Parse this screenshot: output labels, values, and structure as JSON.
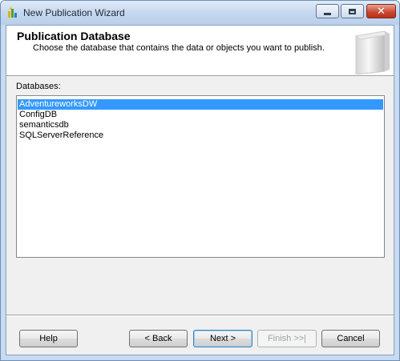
{
  "window": {
    "title": "New Publication Wizard"
  },
  "header": {
    "title": "Publication Database",
    "subtitle": "Choose the database that contains the data or objects you want to publish."
  },
  "databases": {
    "label": "Databases:",
    "items": [
      {
        "label": "AdventureworksDW",
        "selected": true
      },
      {
        "label": "ConfigDB",
        "selected": false
      },
      {
        "label": "semanticsdb",
        "selected": false
      },
      {
        "label": "SQLServerReference",
        "selected": false
      }
    ]
  },
  "buttons": {
    "help": "Help",
    "back": "< Back",
    "next": "Next >",
    "finish": "Finish >>|",
    "cancel": "Cancel"
  },
  "icons": {
    "app": "wizard-icon",
    "minimize": "minimize-icon",
    "maximize": "maximize-icon",
    "close": "close-icon",
    "header": "database-cylinder-graphic"
  },
  "colors": {
    "selection": "#3399ff",
    "close_button": "#c9452d"
  }
}
